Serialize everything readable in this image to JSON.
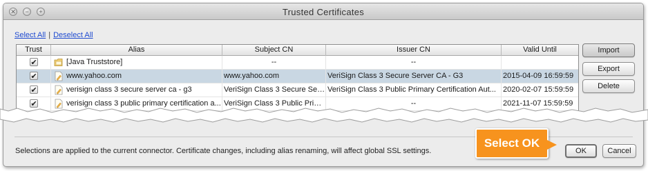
{
  "window": {
    "title": "Trusted Certificates"
  },
  "links": {
    "select_all": "Select All",
    "separator": "|",
    "deselect_all": "Deselect All"
  },
  "table": {
    "headers": [
      "Trust",
      "Alias",
      "Subject CN",
      "Issuer CN",
      "Valid Until"
    ],
    "rows": [
      {
        "trust": true,
        "alias": "[Java Truststore]",
        "alias_icon": "folder-icon",
        "subject": "--",
        "issuer": "--",
        "valid": "",
        "selected": false
      },
      {
        "trust": true,
        "alias": "www.yahoo.com",
        "alias_icon": "certificate-icon",
        "subject": "www.yahoo.com",
        "issuer": "VeriSign Class 3 Secure Server CA - G3",
        "valid": "2015-04-09 16:59:59",
        "selected": true
      },
      {
        "trust": true,
        "alias": "verisign class 3 secure server ca - g3",
        "alias_icon": "certificate-icon",
        "subject": "VeriSign Class 3 Secure Ser...",
        "issuer": "VeriSign Class 3 Public Primary Certification Aut...",
        "valid": "2020-02-07 15:59:59",
        "selected": false
      },
      {
        "trust": true,
        "alias": "verisign class 3 public primary certification a...",
        "alias_icon": "certificate-icon",
        "subject": "VeriSign Class 3 Public Prim...",
        "issuer": "--",
        "valid": "2021-11-07 15:59:59",
        "selected": false
      }
    ]
  },
  "buttons": {
    "import": "Import",
    "export": "Export",
    "delete": "Delete",
    "ok": "OK",
    "cancel": "Cancel"
  },
  "status_text": "Selections are applied to the current connector. Certificate changes, including alias renaming, will affect global SSL settings.",
  "callout": {
    "text": "Select OK",
    "color": "#f7931e"
  },
  "colors": {
    "selected_row": "#c9d7e3",
    "link": "#1f4bd0"
  }
}
